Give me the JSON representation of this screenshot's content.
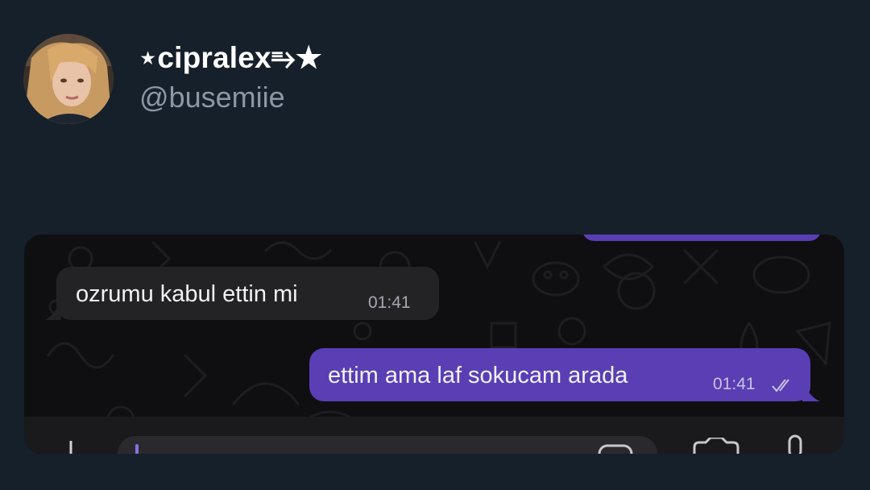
{
  "post": {
    "display_name": "⋆cipralex⥱★",
    "handle": "@busemiie"
  },
  "chat": {
    "messages": [
      {
        "direction": "incoming",
        "text": "ozrumu kabul ettin mi",
        "time": "01:41"
      },
      {
        "direction": "outgoing",
        "text": "ettim ama laf sokucam arada",
        "time": "01:41",
        "status": "read"
      }
    ]
  },
  "colors": {
    "page_bg": "#16202a",
    "incoming_bubble": "#232326",
    "outgoing_bubble": "#5a3eb4",
    "chat_bg": "#0f0f11"
  },
  "icons": [
    "avatar-photo",
    "plus-icon",
    "emoji-icon",
    "camera-icon",
    "mic-icon",
    "double-check-icon"
  ]
}
